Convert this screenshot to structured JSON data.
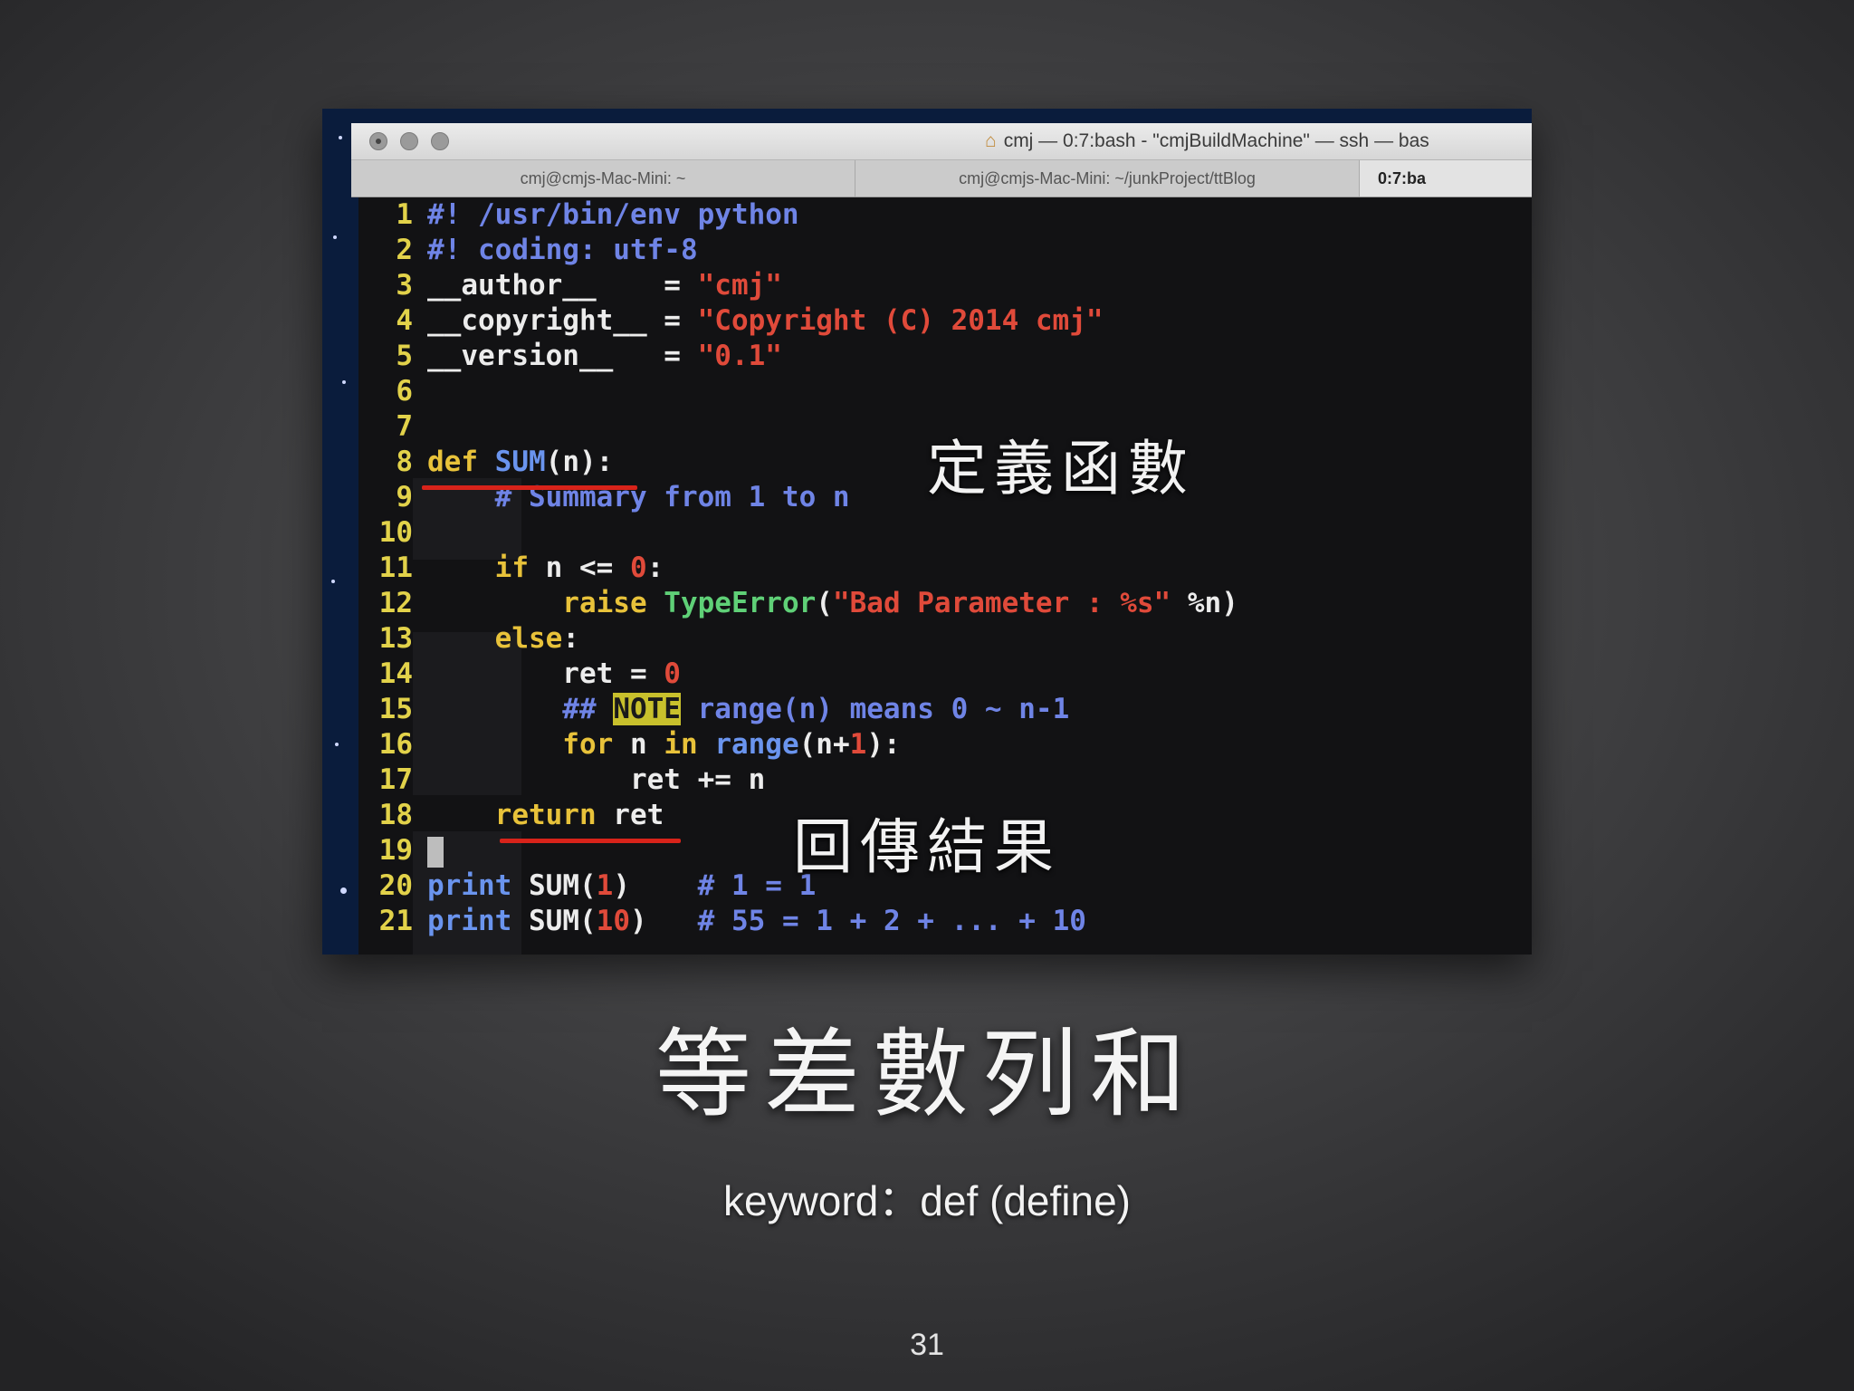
{
  "terminal": {
    "title": "cmj — 0:7:bash - \"cmjBuildMachine\" — ssh — bas",
    "tabs": [
      {
        "label": "cmj@cmjs-Mac-Mini: ~"
      },
      {
        "label": "cmj@cmjs-Mac-Mini: ~/junkProject/ttBlog"
      },
      {
        "label": "0:7:ba"
      }
    ]
  },
  "code": {
    "line_numbers": [
      "1",
      "2",
      "3",
      "4",
      "5",
      "6",
      "7",
      "8",
      "9",
      "10",
      "11",
      "12",
      "13",
      "14",
      "15",
      "16",
      "17",
      "18",
      "19",
      "20",
      "21"
    ],
    "l1": "#! /usr/bin/env python",
    "l2": "#! coding: utf-8",
    "l3a": "__author__    = ",
    "l3b": "\"cmj\"",
    "l4a": "__copyright__ = ",
    "l4b": "\"Copyright (C) 2014 cmj\"",
    "l5a": "__version__   = ",
    "l5b": "\"0.1\"",
    "l8a": "def ",
    "l8b": "SUM",
    "l8c": "(n):",
    "l9": "    # Summary from 1 to n",
    "l11a": "    if",
    "l11b": " n <= ",
    "l11c": "0",
    "l11d": ":",
    "l12a": "        raise ",
    "l12b": "TypeError",
    "l12c": "(",
    "l12d": "\"Bad Parameter : %s\"",
    "l12e": " %n)",
    "l13a": "    else",
    "l13b": ":",
    "l14a": "        ret = ",
    "l14b": "0",
    "l15a": "        ## ",
    "l15b": "NOTE",
    "l15c": " range(n) means 0 ~ n-1",
    "l16a": "        for",
    "l16b": " n ",
    "l16c": "in",
    "l16d": " ",
    "l16e": "range",
    "l16f": "(n+",
    "l16g": "1",
    "l16h": "):",
    "l17": "            ret += n",
    "l18a": "    return",
    "l18b": " ret",
    "l20a": "print",
    "l20b": " SUM(",
    "l20c": "1",
    "l20d": ")",
    "l20e": "    # 1 = 1",
    "l21a": "print",
    "l21b": " SUM(",
    "l21c": "10",
    "l21d": ")",
    "l21e": "   # 55 = 1 + 2 + ... + 10"
  },
  "annotations": {
    "define_function": "定義函數",
    "return_result": "回傳結果"
  },
  "slide": {
    "title": "等差數列和",
    "subtitle": "keyword：def (define)",
    "page_number": "31"
  }
}
